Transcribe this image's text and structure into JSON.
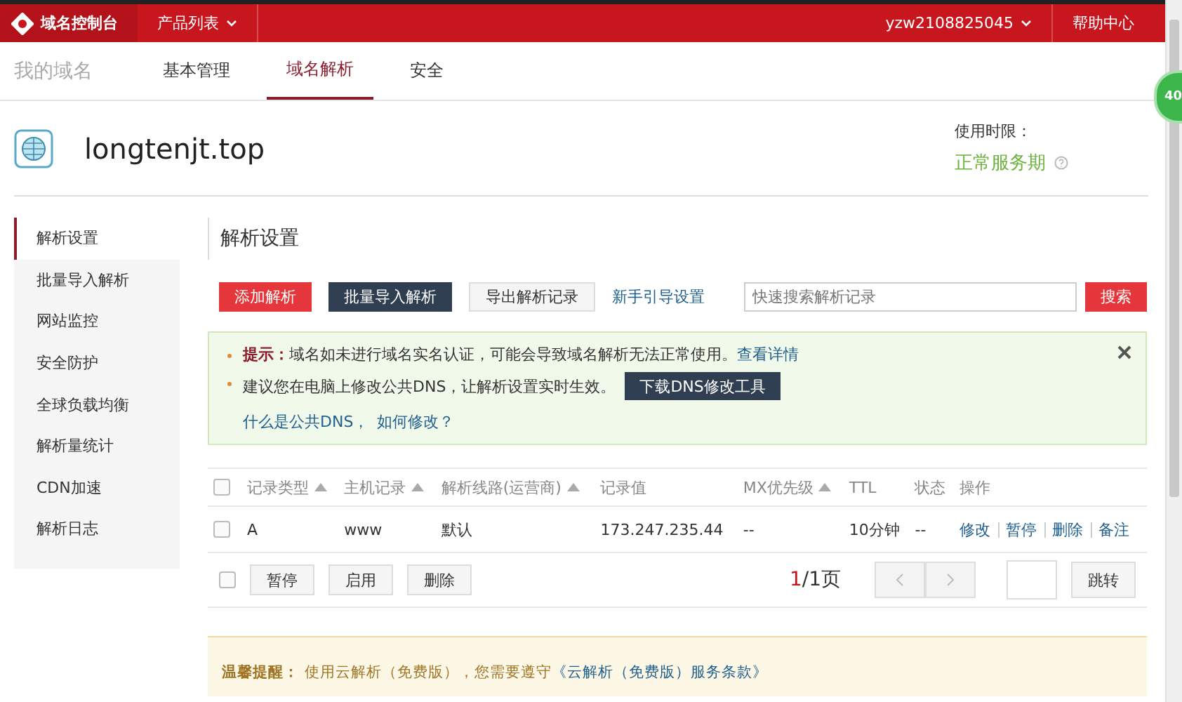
{
  "topbar": {
    "logo": "域名控制台",
    "menu": "产品列表",
    "user": "yzw2108825045",
    "help": "帮助中心"
  },
  "nav": {
    "title": "我的域名",
    "tabs": [
      {
        "label": "基本管理",
        "selected": false
      },
      {
        "label": "域名解析",
        "selected": true
      },
      {
        "label": "安全",
        "selected": false
      }
    ]
  },
  "domain": {
    "name": "longtenjt.top",
    "period_label": "使用时限：",
    "period_status": "正常服务期"
  },
  "float_badge": "40",
  "sidebar": {
    "items": [
      {
        "label": "解析设置",
        "selected": true
      },
      {
        "label": "批量导入解析",
        "selected": false
      },
      {
        "label": "网站监控",
        "selected": false
      },
      {
        "label": "安全防护",
        "selected": false
      },
      {
        "label": "全球负载均衡",
        "selected": false
      },
      {
        "label": "解析量统计",
        "selected": false
      },
      {
        "label": "CDN加速",
        "selected": false
      },
      {
        "label": "解析日志",
        "selected": false
      }
    ]
  },
  "main": {
    "title": "解析设置",
    "toolbar": [
      {
        "label": "添加解析",
        "kind": "primary"
      },
      {
        "label": "批量导入解析",
        "kind": "dark"
      },
      {
        "label": "导出解析记录",
        "kind": "plain"
      },
      {
        "label": "新手引导设置",
        "kind": "link"
      }
    ],
    "search": {
      "placeholder": "快速搜索解析记录",
      "button": "搜索"
    },
    "notices": [
      {
        "lead": "提示：",
        "text": "域名如未进行域名实名认证，可能会导致域名解析无法正常使用。",
        "links": [
          "查看详情"
        ]
      },
      {
        "text": "建议您在电脑上修改公共DNS，让解析设置实时生效。",
        "button": "下载DNS修改工具",
        "links": [
          "什么是公共DNS，",
          "如何修改？"
        ]
      }
    ],
    "table": {
      "columns": [
        {
          "label": "记录类型",
          "sortable": true
        },
        {
          "label": "主机记录",
          "sortable": true
        },
        {
          "label": "解析线路(运营商)",
          "sortable": true
        },
        {
          "label": "记录值",
          "sortable": false
        },
        {
          "label": "MX优先级",
          "sortable": true
        },
        {
          "label": "TTL",
          "sortable": false
        },
        {
          "label": "状态",
          "sortable": false
        },
        {
          "label": "操作",
          "sortable": false
        }
      ],
      "rows": [
        {
          "checked": false,
          "cells": [
            "A",
            "www",
            "默认",
            "173.247.235.44",
            "--",
            "10分钟",
            "--"
          ],
          "actions": [
            "修改",
            "暂停",
            "删除",
            "备注"
          ]
        }
      ]
    },
    "select_all_checked": false,
    "bulk_checked": false,
    "bulk_actions": [
      "暂停",
      "启用",
      "删除"
    ],
    "pagination": {
      "current": "1",
      "total": "/1页",
      "jump": "跳转"
    },
    "footer_notice": {
      "lead": "温馨提醒：",
      "text": "使用云解析（免费版），您需要遵守",
      "link": "《云解析（免费版）服务条款》"
    }
  }
}
